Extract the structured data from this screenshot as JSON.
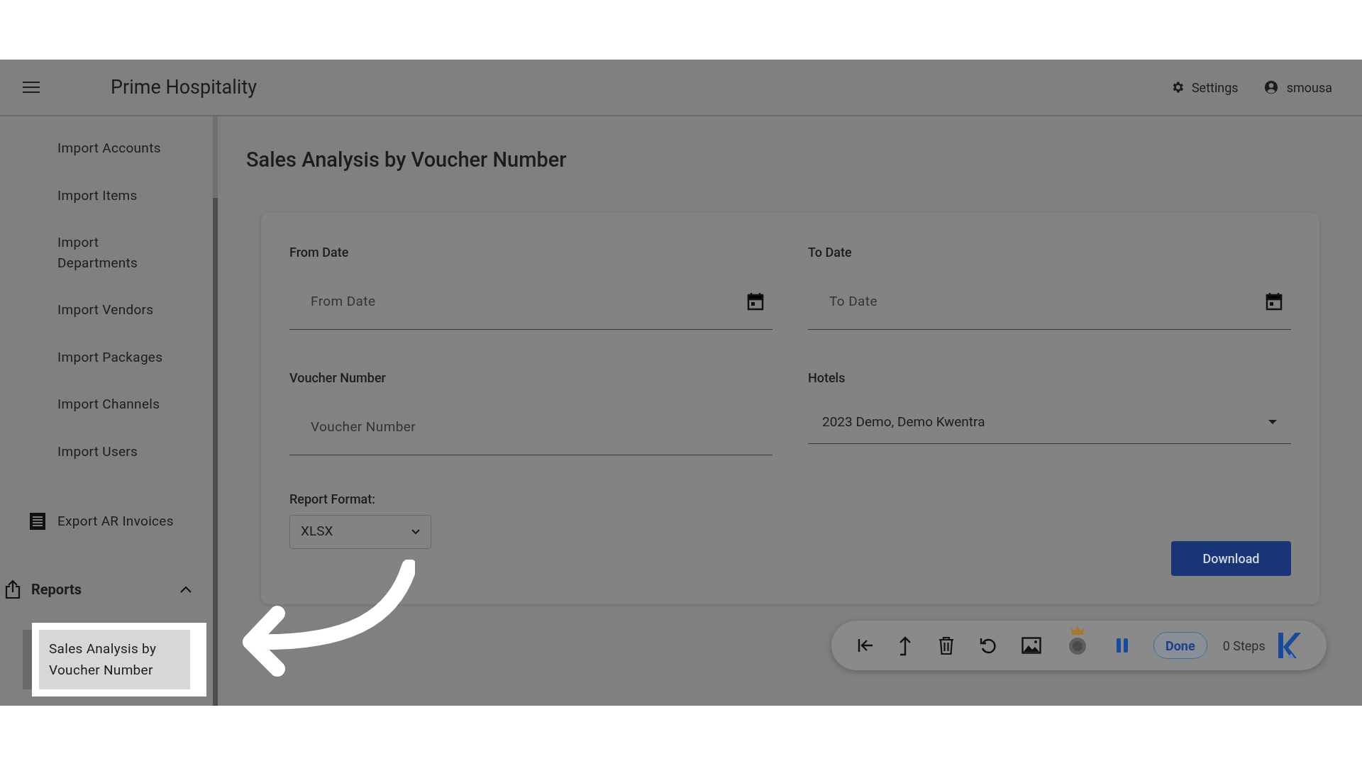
{
  "header": {
    "title": "Prime Hospitality",
    "settings": "Settings",
    "user": "smousa"
  },
  "sidebar": {
    "items": [
      {
        "label": "Import Accounts",
        "kind": "plain"
      },
      {
        "label": "Import Items",
        "kind": "plain"
      },
      {
        "label": "Import Departments",
        "kind": "plain"
      },
      {
        "label": "Import Vendors",
        "kind": "plain"
      },
      {
        "label": "Import Packages",
        "kind": "plain"
      },
      {
        "label": "Import Channels",
        "kind": "plain"
      },
      {
        "label": "Import Users",
        "kind": "plain"
      },
      {
        "label": "Export AR Invoices",
        "kind": "receipt"
      }
    ],
    "group": {
      "label": "Reports",
      "expanded": true,
      "children": [
        {
          "label": "Sales Analysis by Voucher Number",
          "selected": true
        }
      ]
    }
  },
  "page": {
    "title": "Sales Analysis by Voucher Number",
    "fields": [
      {
        "label": "From Date",
        "kind": "date",
        "placeholder": "From Date"
      },
      {
        "label": "To Date",
        "kind": "date",
        "placeholder": "To Date"
      },
      {
        "label": "Voucher Number",
        "kind": "text",
        "placeholder": "Voucher Number"
      },
      {
        "label": "Hotels",
        "kind": "select",
        "value": "2023 Demo, Demo Kwentra"
      }
    ],
    "format": {
      "label": "Report Format:",
      "value": "XLSX"
    },
    "download": "Download"
  },
  "recorder": {
    "done": "Done",
    "steps": "0 Steps",
    "paused": false
  }
}
